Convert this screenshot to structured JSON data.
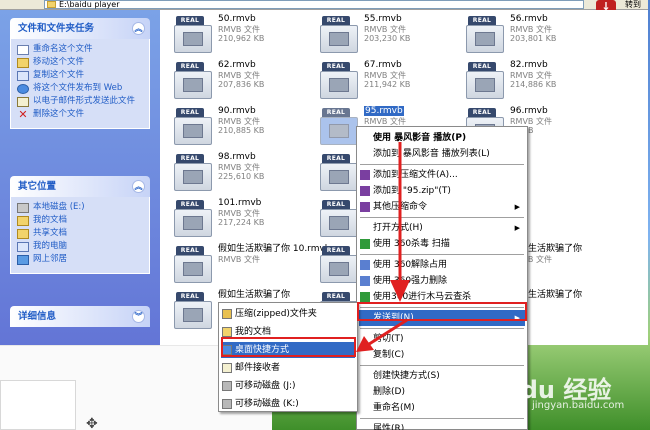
{
  "address": {
    "path": "E:\\baidu player",
    "go_label": "转到"
  },
  "taskpane": {
    "file_tasks": {
      "title": "文件和文件夹任务",
      "items": [
        {
          "label": "重命名这个文件",
          "icon": "rename-icon"
        },
        {
          "label": "移动这个文件",
          "icon": "move-icon"
        },
        {
          "label": "复制这个文件",
          "icon": "copy-icon"
        },
        {
          "label": "将这个文件发布到 Web",
          "icon": "web-publish-icon"
        },
        {
          "label": "以电子邮件形式发送此文件",
          "icon": "email-icon"
        },
        {
          "label": "删除这个文件",
          "icon": "delete-icon"
        }
      ]
    },
    "other_places": {
      "title": "其它位置",
      "items": [
        {
          "label": "本地磁盘 (E:)",
          "icon": "drive-icon"
        },
        {
          "label": "我的文档",
          "icon": "folder-icon"
        },
        {
          "label": "共享文档",
          "icon": "folder-icon"
        },
        {
          "label": "我的电脑",
          "icon": "computer-icon"
        },
        {
          "label": "网上邻居",
          "icon": "network-icon"
        }
      ]
    },
    "details": {
      "title": "详细信息"
    }
  },
  "files": [
    {
      "name": "50.rmvb",
      "type": "RMVB 文件",
      "size": "210,962 KB"
    },
    {
      "name": "55.rmvb",
      "type": "RMVB 文件",
      "size": "203,230 KB"
    },
    {
      "name": "56.rmvb",
      "type": "RMVB 文件",
      "size": "203,801 KB"
    },
    {
      "name": "62.rmvb",
      "type": "RMVB 文件",
      "size": "207,836 KB"
    },
    {
      "name": "67.rmvb",
      "type": "RMVB 文件",
      "size": "211,942 KB"
    },
    {
      "name": "82.rmvb",
      "type": "RMVB 文件",
      "size": "214,886 KB"
    },
    {
      "name": "90.rmvb",
      "type": "RMVB 文件",
      "size": "210,885 KB"
    },
    {
      "name": "95.rmvb",
      "type": "RMVB 文件",
      "size": ""
    },
    {
      "name": "96.rmvb",
      "type": "RMVB 文件",
      "size": "54 KB"
    },
    {
      "name": "98.rmvb",
      "type": "RMVB 文件",
      "size": "225,610 KB"
    },
    {
      "name": "",
      "type": "",
      "size": ""
    },
    {
      "name": "",
      "type": "",
      "size": ""
    },
    {
      "name": "101.rmvb",
      "type": "RMVB 文件",
      "size": "217,224 KB"
    },
    {
      "name": "",
      "type": "",
      "size": ""
    },
    {
      "name": "",
      "type": "",
      "size": ""
    },
    {
      "name": "假如生活欺骗了你 10.rmvb",
      "type": "RMVB 文件",
      "size": ""
    },
    {
      "name": "",
      "type": "",
      "size": ""
    },
    {
      "name": "假如生活欺骗了你",
      "type": "RMVB 文件",
      "size": ""
    },
    {
      "name": "假如生活欺骗了你",
      "type": "",
      "size": ""
    },
    {
      "name": "",
      "type": "",
      "size": ""
    },
    {
      "name": "假如生活欺骗了你",
      "type": "",
      "size": ""
    }
  ],
  "context_menu": {
    "items": [
      {
        "label": "使用 暴风影音 播放(P)",
        "bold": true,
        "icon": ""
      },
      {
        "label": "添加到 暴风影音 播放列表(L)",
        "bold": false,
        "icon": ""
      },
      {
        "sep": true
      },
      {
        "label": "添加到压缩文件(A)...",
        "bold": false,
        "icon": "winrar-icon"
      },
      {
        "label": "添加到 \"95.zip\"(T)",
        "bold": false,
        "icon": "winrar-icon"
      },
      {
        "label": "其他压缩命令",
        "bold": false,
        "icon": "winrar-icon",
        "submenu": true
      },
      {
        "sep": true
      },
      {
        "label": "打开方式(H)",
        "bold": false,
        "icon": "",
        "submenu": true
      },
      {
        "label": "使用 360杀毒 扫描",
        "bold": false,
        "icon": "shield-icon"
      },
      {
        "sep": true
      },
      {
        "label": "使用 360解除占用",
        "bold": false,
        "icon": "tool-icon"
      },
      {
        "label": "使用 360强力删除",
        "bold": false,
        "icon": "tool-icon"
      },
      {
        "label": "使用360进行木马云查杀",
        "bold": false,
        "icon": "trojan-scan-icon"
      },
      {
        "sep": true
      },
      {
        "label": "发送到(N)",
        "bold": false,
        "icon": "",
        "submenu": true,
        "highlight": true
      },
      {
        "sep": true
      },
      {
        "label": "剪切(T)",
        "bold": false,
        "icon": ""
      },
      {
        "label": "复制(C)",
        "bold": false,
        "icon": ""
      },
      {
        "sep": true
      },
      {
        "label": "创建快捷方式(S)",
        "bold": false,
        "icon": ""
      },
      {
        "label": "删除(D)",
        "bold": false,
        "icon": ""
      },
      {
        "label": "重命名(M)",
        "bold": false,
        "icon": ""
      },
      {
        "sep": true
      },
      {
        "label": "属性(R)",
        "bold": false,
        "icon": ""
      }
    ]
  },
  "send_to_menu": {
    "items": [
      {
        "label": "压缩(zipped)文件夹",
        "icon": "zip-folder-icon"
      },
      {
        "label": "我的文档",
        "icon": "folder-icon"
      },
      {
        "label": "桌面快捷方式",
        "icon": "desktop-icon",
        "highlight": true
      },
      {
        "label": "邮件接收者",
        "icon": "mail-icon"
      },
      {
        "label": "可移动磁盘 (J:)",
        "icon": "drive-icon"
      },
      {
        "label": "可移动磁盘 (K:)",
        "icon": "drive-icon"
      }
    ]
  },
  "watermark": {
    "brand": "Baidu 经验",
    "url": "jingyan.baidu.com"
  },
  "colors": {
    "highlight": "#316ac5",
    "annotation_red": "#e02020",
    "taskpane_blue": "#6375d6"
  }
}
